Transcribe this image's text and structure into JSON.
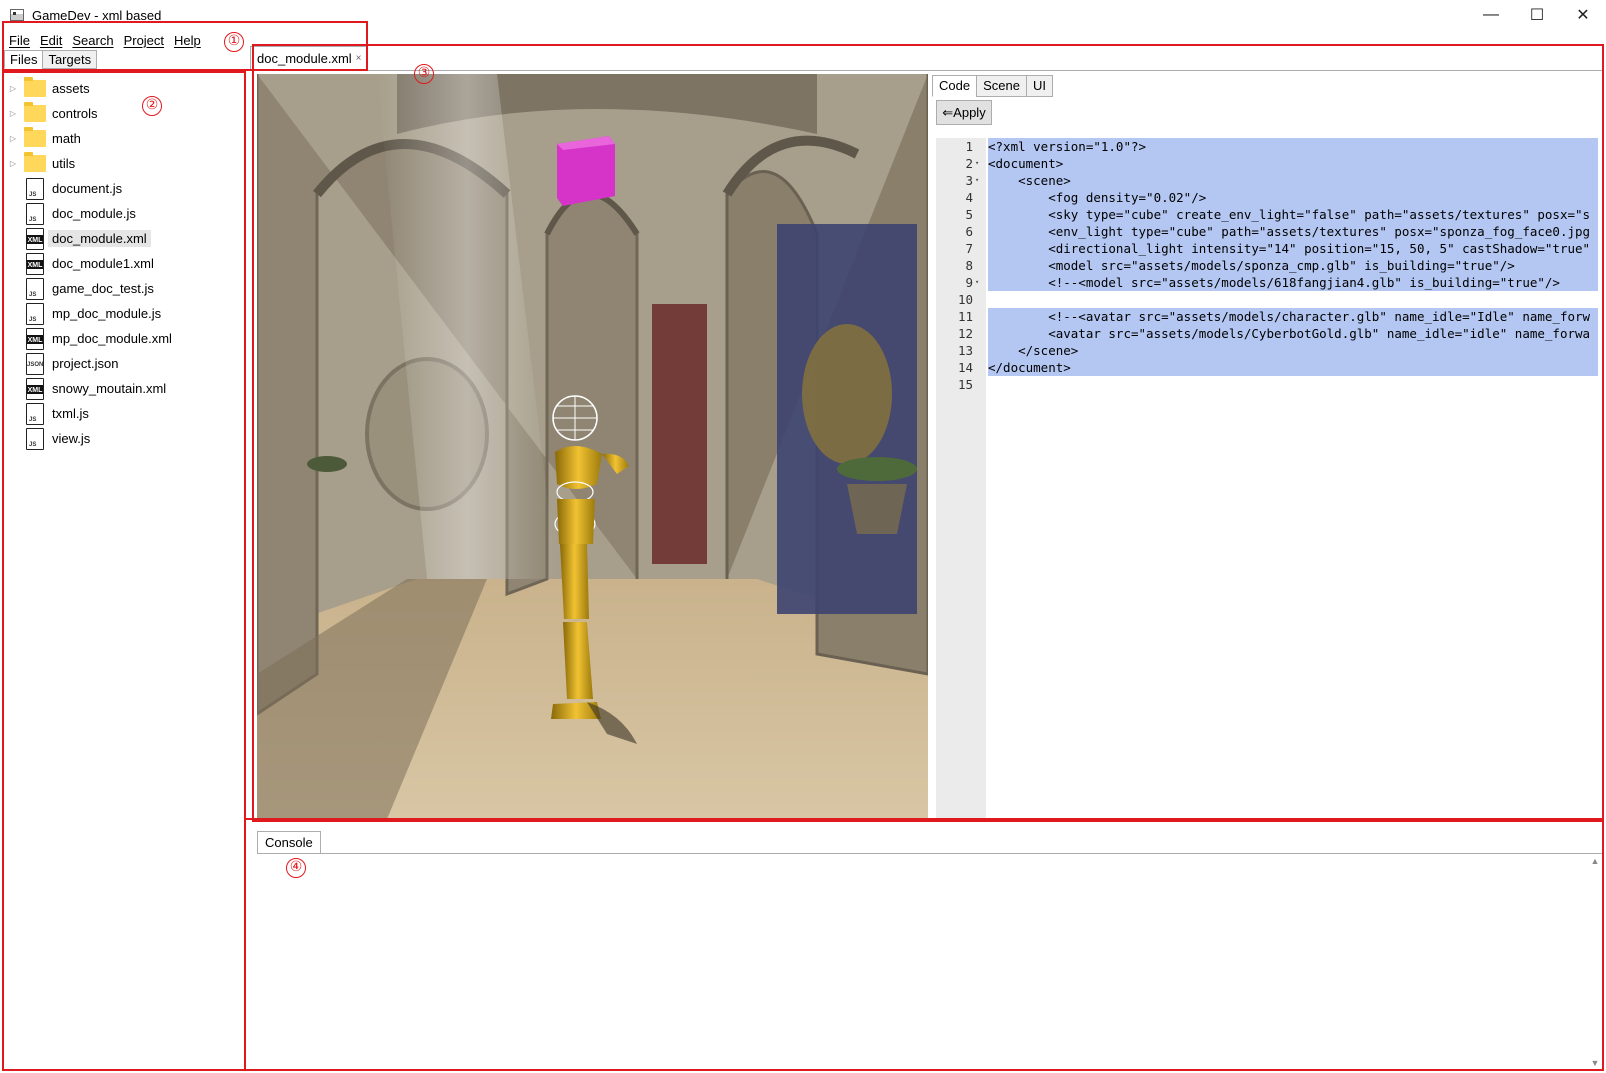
{
  "window": {
    "title": "GameDev - xml based",
    "controls": {
      "minimize": "—",
      "maximize": "☐",
      "close": "✕"
    }
  },
  "menu": [
    "File",
    "Edit",
    "Search",
    "Project",
    "Help"
  ],
  "left_panel": {
    "tabs": [
      "Files",
      "Targets"
    ],
    "active_tab": "Files",
    "tree": [
      {
        "label": "assets",
        "type": "folder"
      },
      {
        "label": "controls",
        "type": "folder"
      },
      {
        "label": "math",
        "type": "folder"
      },
      {
        "label": "utils",
        "type": "folder"
      },
      {
        "label": "document.js",
        "type": "js"
      },
      {
        "label": "doc_module.js",
        "type": "js"
      },
      {
        "label": "doc_module.xml",
        "type": "xml",
        "selected": true
      },
      {
        "label": "doc_module1.xml",
        "type": "xml"
      },
      {
        "label": "game_doc_test.js",
        "type": "js"
      },
      {
        "label": "mp_doc_module.js",
        "type": "js"
      },
      {
        "label": "mp_doc_module.xml",
        "type": "xml"
      },
      {
        "label": "project.json",
        "type": "json"
      },
      {
        "label": "snowy_moutain.xml",
        "type": "xml"
      },
      {
        "label": "txml.js",
        "type": "js"
      },
      {
        "label": "view.js",
        "type": "js"
      }
    ],
    "icon_text": {
      "xml": "XML",
      "json": "JSON"
    }
  },
  "document_tabs": [
    {
      "label": "doc_module.xml",
      "close": "×"
    }
  ],
  "code_panel": {
    "tabs": [
      "Code",
      "Scene",
      "UI"
    ],
    "active_tab": "Code",
    "apply_label": "⇐Apply",
    "lines": [
      {
        "n": "1",
        "fold": "",
        "text": "<?xml version=\"1.0\"?>"
      },
      {
        "n": "2",
        "fold": "▾",
        "text": "<document>"
      },
      {
        "n": "3",
        "fold": "▾",
        "text": "    <scene>"
      },
      {
        "n": "4",
        "fold": "",
        "text": "        <fog density=\"0.02\"/>"
      },
      {
        "n": "5",
        "fold": "",
        "text": "        <sky type=\"cube\" create_env_light=\"false\" path=\"assets/textures\" posx=\"s"
      },
      {
        "n": "6",
        "fold": "",
        "text": "        <env_light type=\"cube\" path=\"assets/textures\" posx=\"sponza_fog_face0.jpg"
      },
      {
        "n": "7",
        "fold": "",
        "text": "        <directional_light intensity=\"14\" position=\"15, 50, 5\" castShadow=\"true\""
      },
      {
        "n": "8",
        "fold": "",
        "text": "        <model src=\"assets/models/sponza_cmp.glb\" is_building=\"true\"/>"
      },
      {
        "n": "9",
        "fold": "▾",
        "text": "        <!--<model src=\"assets/models/618fangjian4.glb\" is_building=\"true\"/>"
      },
      {
        "n": "10",
        "fold": "",
        "text": ""
      },
      {
        "n": "11",
        "fold": "",
        "text": "        <!--<avatar src=\"assets/models/character.glb\" name_idle=\"Idle\" name_forw"
      },
      {
        "n": "12",
        "fold": "",
        "text": "        <avatar src=\"assets/models/CyberbotGold.glb\" name_idle=\"idle\" name_forwa"
      },
      {
        "n": "13",
        "fold": "",
        "text": "    </scene>"
      },
      {
        "n": "14",
        "fold": "",
        "text": "</document>"
      },
      {
        "n": "15",
        "fold": "",
        "text": ""
      }
    ],
    "selected_lines": 14
  },
  "console": {
    "tabs": [
      "Console"
    ],
    "scroll_up": "▲",
    "scroll_down": "▼"
  },
  "annotations": [
    "①",
    "②",
    "③",
    "④"
  ],
  "colors": {
    "annotation_red": "#e0191e",
    "selection_blue": "#b4c7f2",
    "folder_yellow": "#ffd75a",
    "cube_magenta": "#d633c9",
    "robot_gold": "#d4a017"
  }
}
